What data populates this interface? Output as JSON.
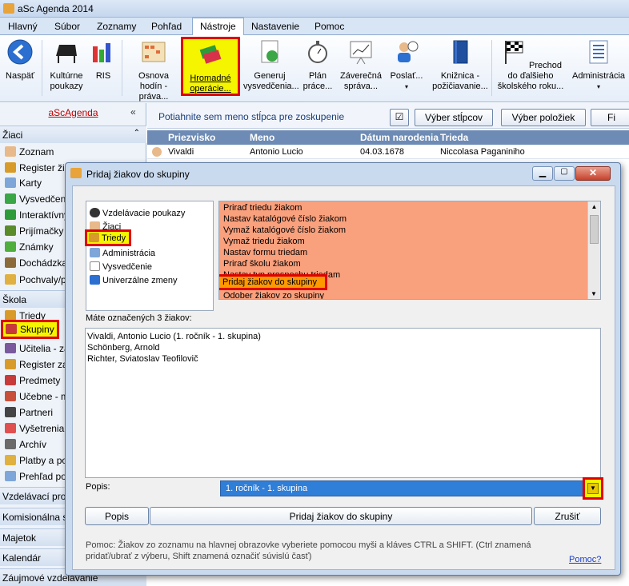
{
  "window": {
    "title": "aSc Agenda 2014"
  },
  "menu": [
    "Hlavný",
    "Súbor",
    "Zoznamy",
    "Pohľad",
    "Nástroje",
    "Nastavenie",
    "Pomoc"
  ],
  "ribbon": {
    "back": "Naspäť",
    "vouchers": "Kultúrne poukazy",
    "ris": "RIS",
    "syllabus": "Osnova hodín - práva...",
    "bulk": "Hromadné operácie...",
    "certificates": "Generuj vysvedčenia...",
    "workplan": "Plán práce...",
    "final": "Záverečná správa...",
    "send": "Poslať...",
    "library": "Knižnica - požičiavanie...",
    "transition": "Prechod do ďalšieho školského roku...",
    "admin": "Administrácia"
  },
  "left": {
    "brand": "aScAgenda",
    "sec_students": "Žiaci",
    "students": [
      "Zoznam",
      "Register žia",
      "Karty",
      "Vysvedčeni",
      "Interaktívny",
      "Prijímačky",
      "Známky",
      "Dochádzka",
      "Pochvaly/po"
    ],
    "sec_school": "Škola",
    "school": [
      "Triedy",
      "Skupiny",
      "Učitelia - za",
      "Register za",
      "Predmety",
      "Učebne - m",
      "Partneri",
      "Vyšetrenia",
      "Archív",
      "Platby a po",
      "Prehľad po"
    ],
    "sections": [
      "Vzdelávací prog",
      "Komisionálna sk",
      "Majetok",
      "Kalendár",
      "Záujmové vzdelávanie"
    ]
  },
  "grid": {
    "hint": "Potiahnite sem meno stĺpca pre zoskupenie",
    "btn_columns": "Výber stĺpcov",
    "btn_items": "Výber položiek",
    "btn_fi": "Fi",
    "headers": [
      "Priezvisko",
      "Meno",
      "Dátum narodenia",
      "Trieda"
    ],
    "row": [
      "Vivaldi",
      "Antonio Lucio",
      "04.03.1678",
      "Niccolasa Paganiniho"
    ]
  },
  "dialog": {
    "title": "Pridaj žiakov do skupiny",
    "tree": [
      "Vzdelávacie poukazy",
      "Žiaci",
      "Triedy",
      "Administrácia",
      "Vysvedčenie",
      "Univerzálne zmeny"
    ],
    "ops": [
      "Priraď triedu žiakom",
      "Nastav katalógové číslo žiakom",
      "Vymaž katalógové číslo žiakom",
      "Vymaž triedu žiakom",
      "Nastav formu triedam",
      "Priraď školu žiakom",
      "Nastav typ prospechu triedam",
      "Pridaj žiakov do skupiny",
      "Odober žiakov zo skupiny"
    ],
    "marked_label": "Máte označených 3 žiakov:",
    "marked": [
      "Vivaldi, Antonio Lucio (1. ročník - 1. skupina)",
      "Schönberg, Arnold",
      "Richter, Sviatoslav Teofilovič"
    ],
    "popis_label": "Popis:",
    "popis_value": "1. ročník - 1. skupina",
    "btn_popis": "Popis",
    "btn_add": "Pridaj žiakov do skupiny",
    "btn_cancel": "Zrušiť",
    "help": "Pomoc: Žiakov zo zoznamu na hlavnej obrazovke vyberiete pomocou myši a kláves CTRL a SHIFT. (Ctrl znamená pridať/ubrať z výberu, Shift znamená označiť súvislú časť)",
    "help_link": "Pomoc?"
  }
}
